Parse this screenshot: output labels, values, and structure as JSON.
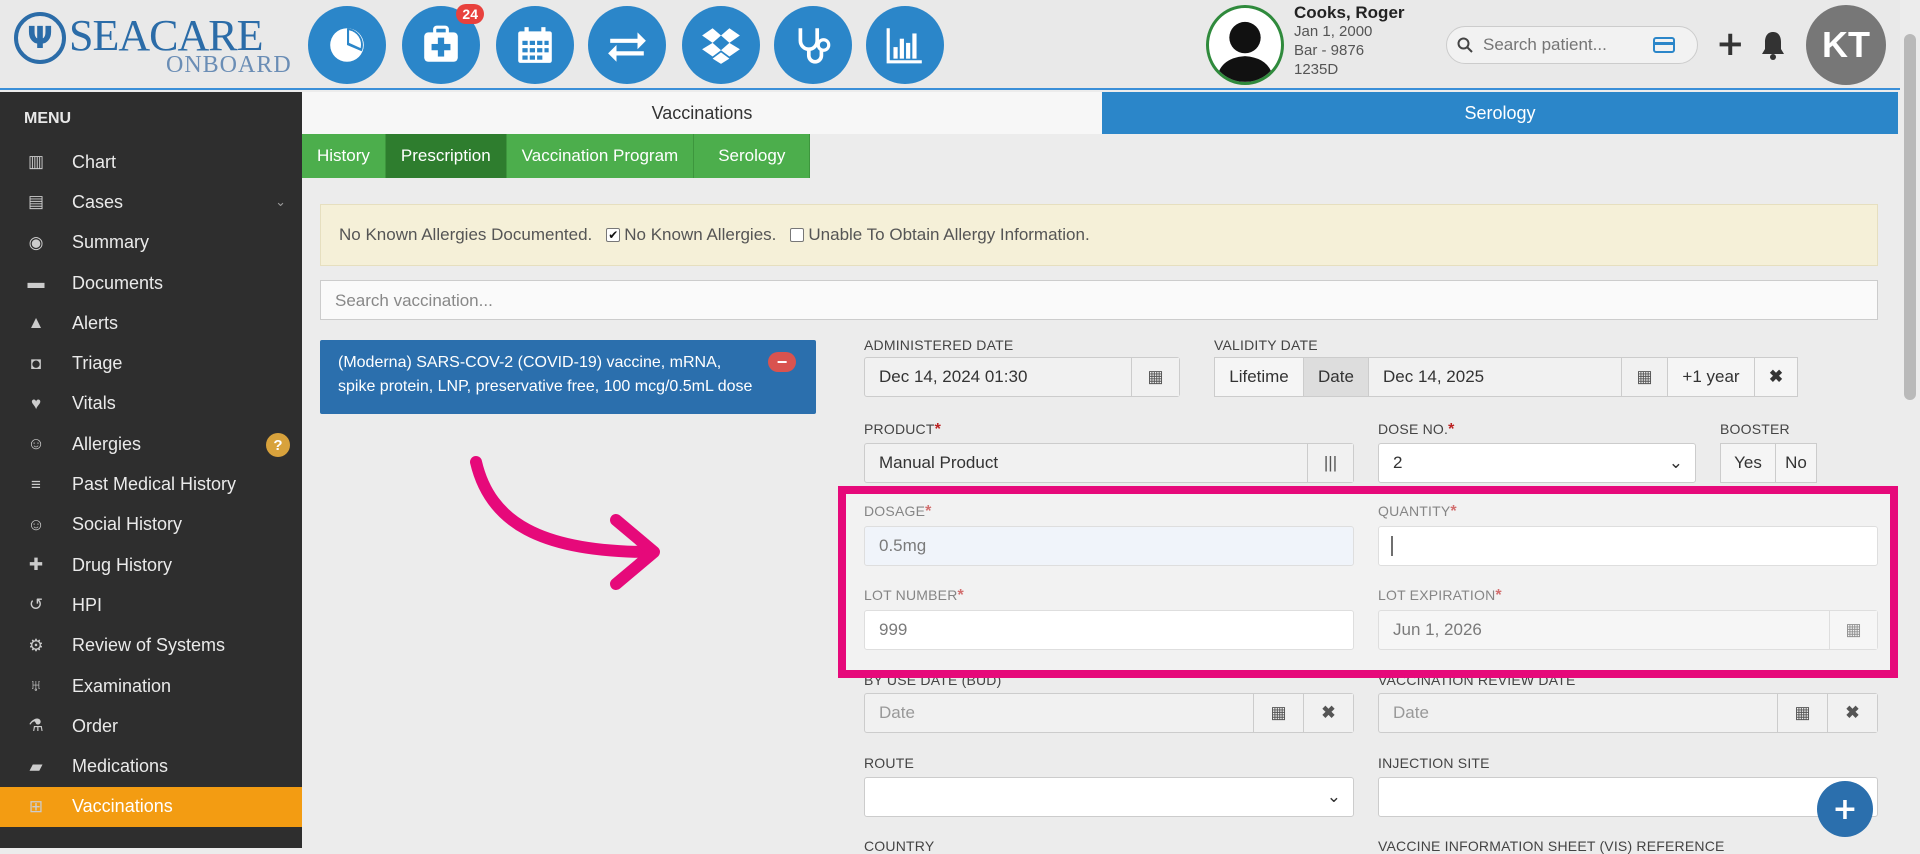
{
  "logo": {
    "name": "SEACARE",
    "sub": "ONBOARD"
  },
  "nav": {
    "badge_count": "24",
    "icons": [
      "pie-chart-icon",
      "add-case-icon",
      "calendar-icon",
      "transfer-icon",
      "dropbox-icon",
      "stethoscope-icon",
      "bar-chart-icon"
    ]
  },
  "patient": {
    "name": "Cooks, Roger",
    "dob": "Jan 1, 2000",
    "id": "Bar - 9876",
    "code": "1235D"
  },
  "search": {
    "placeholder": "Search patient..."
  },
  "user": {
    "initials": "KT"
  },
  "sidebar": {
    "title": "MENU",
    "items": [
      {
        "label": "Chart",
        "icon": "bar-chart-icon"
      },
      {
        "label": "Cases",
        "icon": "archive-icon"
      },
      {
        "label": "Summary",
        "icon": "eye-icon"
      },
      {
        "label": "Documents",
        "icon": "folder-icon"
      },
      {
        "label": "Alerts",
        "icon": "warning-icon"
      },
      {
        "label": "Triage",
        "icon": "inbox-icon"
      },
      {
        "label": "Vitals",
        "icon": "heart-icon"
      },
      {
        "label": "Allergies",
        "icon": "smile-icon",
        "badge": "?"
      },
      {
        "label": "Past Medical History",
        "icon": "sort-icon"
      },
      {
        "label": "Social History",
        "icon": "smile-icon"
      },
      {
        "label": "Drug History",
        "icon": "medkit-icon"
      },
      {
        "label": "HPI",
        "icon": "history-icon"
      },
      {
        "label": "Review of Systems",
        "icon": "gear-icon"
      },
      {
        "label": "Examination",
        "icon": "stethoscope-icon"
      },
      {
        "label": "Order",
        "icon": "flask-icon"
      },
      {
        "label": "Medications",
        "icon": "eraser-icon"
      },
      {
        "label": "Vaccinations",
        "icon": "plus-square-icon",
        "active": true
      }
    ]
  },
  "tabs": {
    "top": [
      "Vaccinations",
      "Serology"
    ],
    "sub": [
      "History",
      "Prescription",
      "Vaccination Program",
      "Serology"
    ]
  },
  "allergy": {
    "message": "No Known Allergies Documented.",
    "nka_label": "No Known Allergies.",
    "unable_label": "Unable To Obtain Allergy Information."
  },
  "vaccine_search": {
    "placeholder": "Search vaccination..."
  },
  "selected_vaccine": {
    "line1": "(Moderna) SARS-COV-2 (COVID-19) vaccine, mRNA,",
    "line2": "spike protein, LNP, preservative free, 100 mcg/0.5mL dose"
  },
  "form": {
    "administered_date": {
      "label": "ADMINISTERED DATE",
      "value": "Dec 14, 2024 01:30"
    },
    "validity_date": {
      "label": "VALIDITY DATE",
      "lifetime": "Lifetime",
      "date_btn": "Date",
      "value": "Dec 14, 2025",
      "plus_year": "+1 year"
    },
    "product": {
      "label": "PRODUCT",
      "value": "Manual Product"
    },
    "dose_no": {
      "label": "DOSE NO.",
      "value": "2"
    },
    "booster": {
      "label": "BOOSTER",
      "yes": "Yes",
      "no": "No"
    },
    "dosage": {
      "label": "DOSAGE",
      "value": "0.5mg"
    },
    "quantity": {
      "label": "QUANTITY",
      "value": ""
    },
    "lot_number": {
      "label": "LOT NUMBER",
      "value": "999"
    },
    "lot_expiration": {
      "label": "LOT EXPIRATION",
      "value": "Jun 1, 2026"
    },
    "bud": {
      "label": "BY USE DATE (BUD)",
      "placeholder": "Date"
    },
    "review_date": {
      "label": "VACCINATION REVIEW DATE",
      "placeholder": "Date"
    },
    "route": {
      "label": "ROUTE"
    },
    "injection_site": {
      "label": "INJECTION SITE"
    },
    "country": {
      "label": "COUNTRY"
    },
    "vis_reference": {
      "label": "VACCINE INFORMATION SHEET (VIS) REFERENCE"
    }
  },
  "colors": {
    "primary": "#2b86c9",
    "green": "#4cae4c",
    "active_menu": "#f39c12",
    "highlight": "#e6097a"
  }
}
